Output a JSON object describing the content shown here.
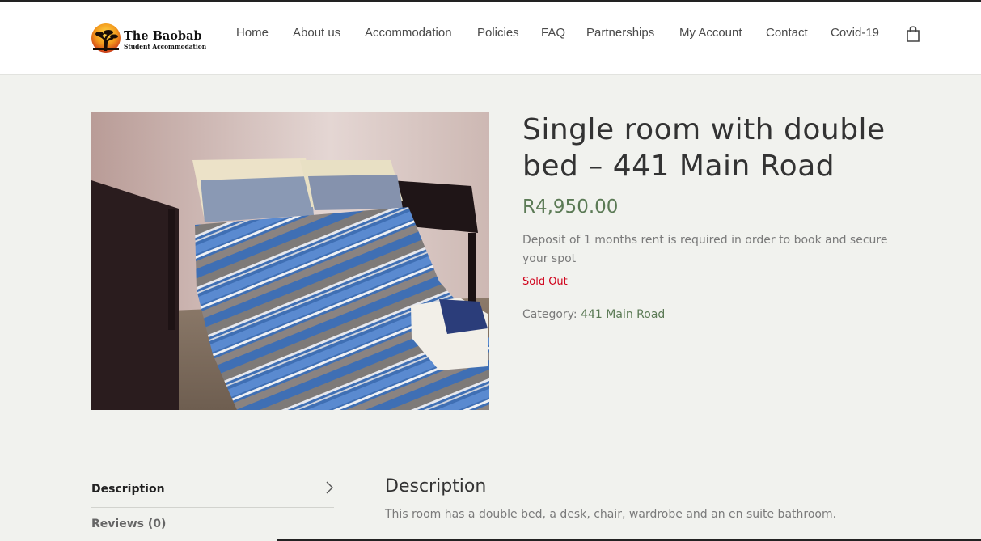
{
  "brand": {
    "name": "The Baobab",
    "tagline": "Student Accommodation"
  },
  "nav": {
    "items": [
      "Home",
      "About us",
      "Accommodation",
      "Policies",
      "FAQ",
      "Partnerships",
      "My Account",
      "Contact",
      "Covid-19"
    ],
    "cart_icon": "shopping-bag-icon"
  },
  "product": {
    "title": "Single room with double bed – 441 Main Road",
    "price": "R4,950.00",
    "short_description": "Deposit of 1 months rent is required in order to book and secure your spot",
    "stock_status": "Sold Out",
    "category_label": "Category:",
    "category": "441 Main Road",
    "image_alt": "bed-photo"
  },
  "tabs": {
    "items": [
      "Description",
      "Reviews (0)"
    ],
    "panel_heading": "Description",
    "panel_text": "This room has a double bed, a desk, chair, wardrobe and an en suite bathroom."
  },
  "colors": {
    "accent": "#5b7a55",
    "sold_out": "#d0021b",
    "background": "#f1f2ee"
  }
}
